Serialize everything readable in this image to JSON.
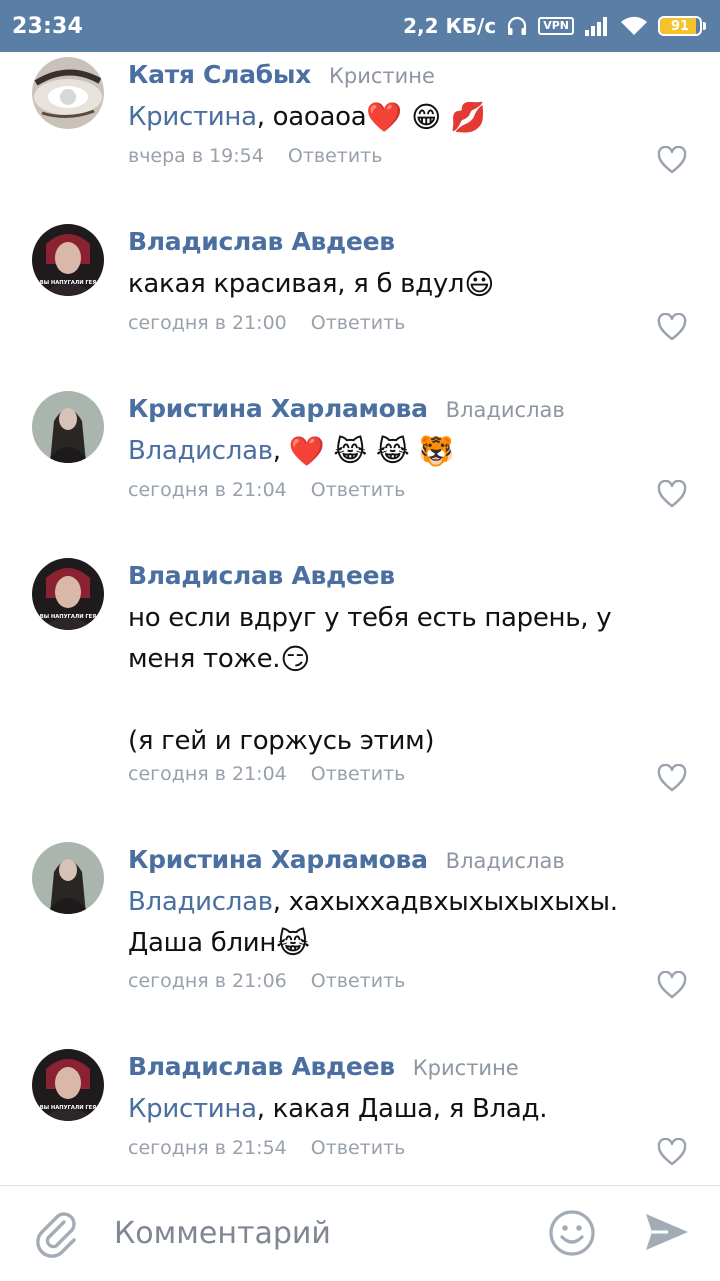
{
  "status_bar": {
    "time": "23:34",
    "speed": "2,2 КБ/с",
    "vpn": "VPN",
    "battery_level": "91",
    "battery_fraction": 0.91,
    "bar_color": "#5b7ea6"
  },
  "colors": {
    "author": "#4a6fa0",
    "meta": "#98a1ab",
    "text": "#111111"
  },
  "comments": [
    {
      "author": "Катя Слабых",
      "reply_to": "Кристине",
      "mention": "Кристина",
      "text": ", оаоаоа",
      "emoji": "❤️ 😁 💋",
      "date": "вчера в 19:54",
      "reply_label": "Ответить"
    },
    {
      "author": "Владислав Авдеев",
      "reply_to": "",
      "text": "какая красивая, я б вдул",
      "emoji": "😃",
      "date": "сегодня в 21:00",
      "reply_label": "Ответить",
      "avatar_caption": "ВЫ НАПУГАЛИ ГЕЯ"
    },
    {
      "author": "Кристина Харламова",
      "reply_to": "Владислав",
      "mention": "Владислав",
      "text": ", ",
      "emoji": "❤️ 😹 😹 🐯",
      "date": "сегодня в 21:04",
      "reply_label": "Ответить"
    },
    {
      "author": "Владислав Авдеев",
      "reply_to": "",
      "text_line1": "но если вдруг у тебя есть парень, у",
      "text_line2": "меня тоже.",
      "emoji": "😏",
      "text_line3": "(я гей и горжусь этим)",
      "date": "сегодня в 21:04",
      "reply_label": "Ответить",
      "avatar_caption": "ВЫ НАПУГАЛИ ГЕЯ"
    },
    {
      "author": "Кристина Харламова",
      "reply_to": "Владислав",
      "mention": "Владислав",
      "text": ", хахыххадвхыхыхыхыхы.",
      "text_line2": "Даша блин",
      "emoji": "😹",
      "date": "сегодня в 21:06",
      "reply_label": "Ответить"
    },
    {
      "author": "Владислав Авдеев",
      "reply_to": "Кристине",
      "mention": "Кристина",
      "text": ", какая Даша, я Влад.",
      "date": "сегодня в 21:54",
      "reply_label": "Ответить",
      "avatar_caption": "ВЫ НАПУГАЛИ ГЕЯ"
    }
  ],
  "composer": {
    "placeholder": "Комментарий",
    "icons": [
      "paperclip-icon",
      "smile-icon",
      "send-icon"
    ]
  }
}
